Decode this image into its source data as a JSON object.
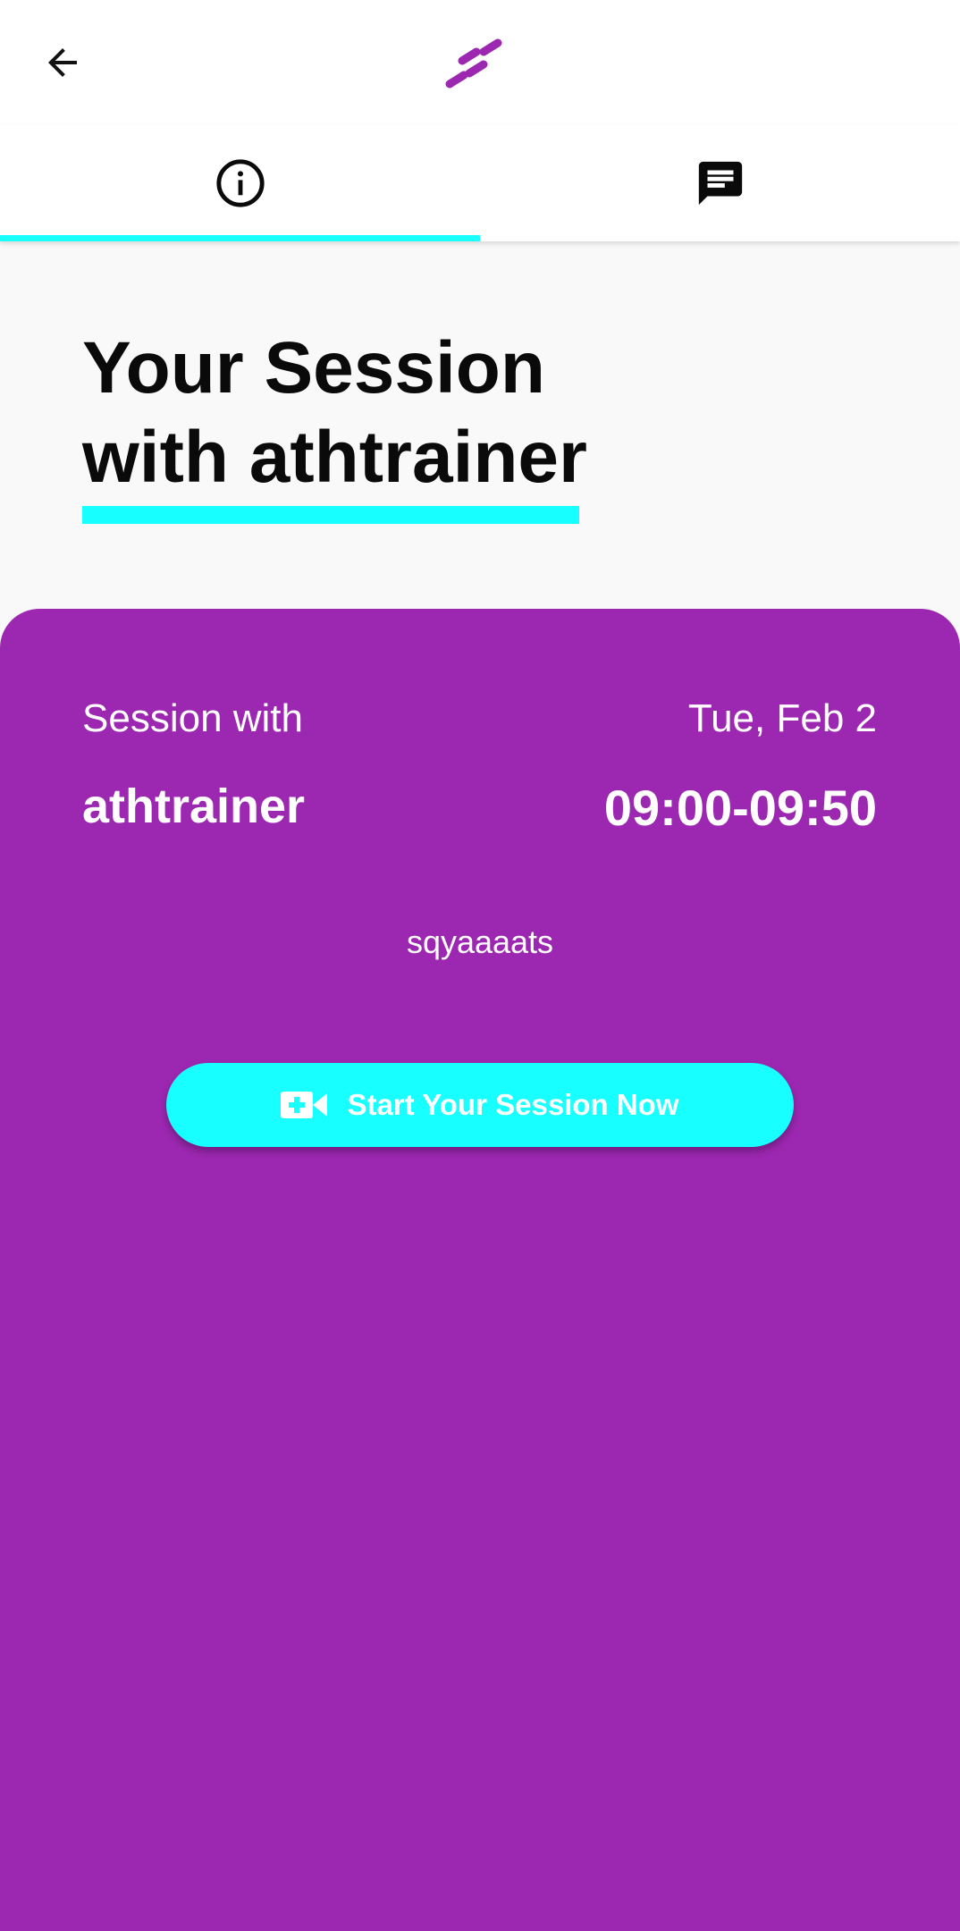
{
  "header": {
    "back_icon": "arrow-left-icon",
    "logo_icon": "brand-stripes-logo"
  },
  "tabs": [
    {
      "icon": "info-circle-icon",
      "selected": true
    },
    {
      "icon": "chat-message-icon",
      "selected": false
    }
  ],
  "title": {
    "line1": "Your Session",
    "line2": "with athtrainer"
  },
  "session": {
    "with_label": "Session with",
    "trainer": "athtrainer",
    "date": "Tue, Feb 2",
    "time": "09:00-09:50",
    "note": "sqyaaaats"
  },
  "start_button": {
    "icon": "video-call-icon",
    "label": "Start Your Session Now"
  },
  "colors": {
    "accent": "#18ffff",
    "card": "#9c27b0",
    "logo": "#9c27b0"
  }
}
